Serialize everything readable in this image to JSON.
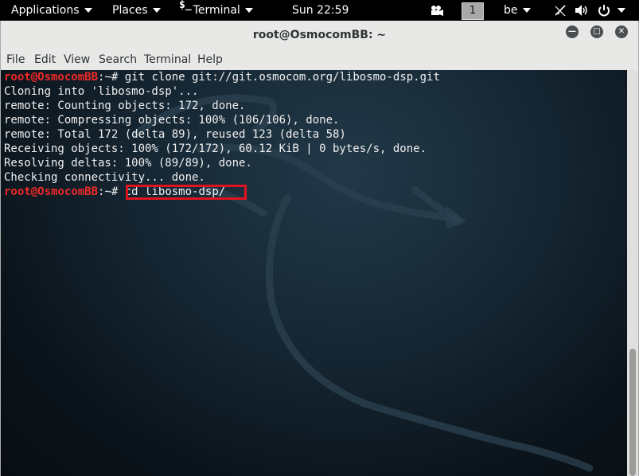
{
  "topbar": {
    "applications": "Applications",
    "places": "Places",
    "terminal_icon": "$_",
    "terminal": "Terminal",
    "clock": "Sun 22:59",
    "workspace": "1",
    "keyboard_layout": "be",
    "icons": [
      "camera-icon",
      "network-off-icon",
      "volume-icon",
      "power-icon"
    ]
  },
  "window": {
    "title": "root@OsmocomBB: ~",
    "menu": [
      "File",
      "Edit",
      "View",
      "Search",
      "Terminal",
      "Help"
    ]
  },
  "terminal": {
    "prompt_user": "root@OsmocomBB",
    "prompt_suffix": ":~#",
    "lines": [
      {
        "type": "command",
        "text": " git clone git://git.osmocom.org/libosmo-dsp.git"
      },
      {
        "type": "output",
        "text": "Cloning into 'libosmo-dsp'..."
      },
      {
        "type": "output",
        "text": "remote: Counting objects: 172, done."
      },
      {
        "type": "output",
        "text": "remote: Compressing objects: 100% (106/106), done."
      },
      {
        "type": "output",
        "text": "remote: Total 172 (delta 89), reused 123 (delta 58)"
      },
      {
        "type": "output",
        "text": "Receiving objects: 100% (172/172), 60.12 KiB | 0 bytes/s, done."
      },
      {
        "type": "output",
        "text": "Resolving deltas: 100% (89/89), done."
      },
      {
        "type": "output",
        "text": "Checking connectivity... done."
      },
      {
        "type": "command",
        "text": " cd libosmo-dsp/"
      }
    ]
  },
  "colors": {
    "prompt": "#ef2929",
    "highlight": "#e0141e",
    "text": "#f0f0f0"
  }
}
